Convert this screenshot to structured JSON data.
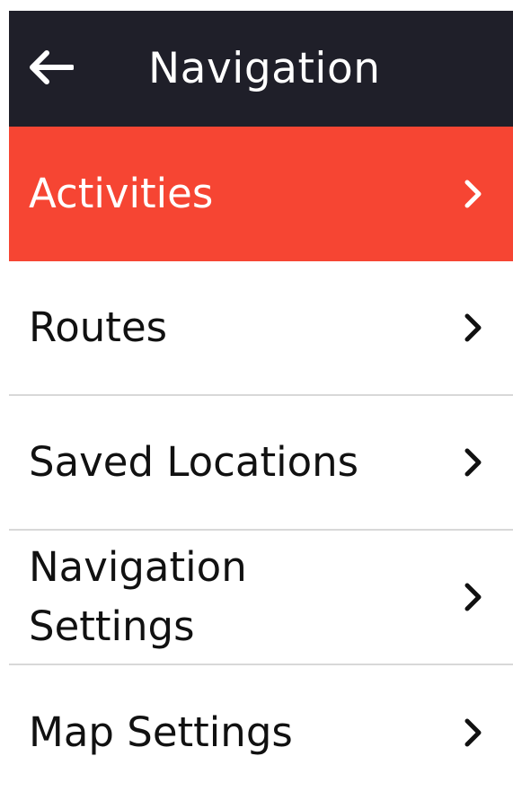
{
  "header": {
    "title": "Navigation",
    "back_icon": "arrow-left-icon"
  },
  "colors": {
    "header_bg": "#1f1f29",
    "active_bg": "#f64533",
    "divider": "#d8d8d8"
  },
  "menu": {
    "items": [
      {
        "label": "Activities",
        "icon": "chevron-right-icon",
        "selected": true
      },
      {
        "label": "Routes",
        "icon": "chevron-right-icon",
        "selected": false
      },
      {
        "label": "Saved Locations",
        "icon": "chevron-right-icon",
        "selected": false
      },
      {
        "label": "Navigation Settings",
        "icon": "chevron-right-icon",
        "selected": false
      },
      {
        "label": "Map Settings",
        "icon": "chevron-right-icon",
        "selected": false
      }
    ]
  }
}
